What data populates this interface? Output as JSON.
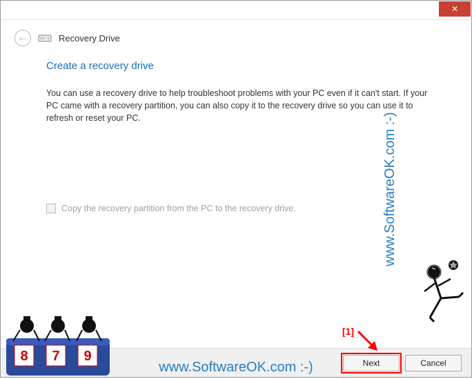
{
  "titlebar": {
    "close_glyph": "✕"
  },
  "header": {
    "back_glyph": "←",
    "title": "Recovery Drive"
  },
  "content": {
    "heading": "Create a recovery drive",
    "body": "You can use a recovery drive to help troubleshoot problems with your PC even if it can't start. If your PC came with a recovery partition, you can also copy it to the recovery drive so you can use it to refresh or reset your PC.",
    "checkbox_label": "Copy the recovery partition from the PC to the recovery drive."
  },
  "footer": {
    "next_label": "Next",
    "cancel_label": "Cancel"
  },
  "annotation": {
    "label": "[1]"
  },
  "watermark": {
    "text": "www.SoftwareOK.com :-)"
  },
  "judges": {
    "scores": [
      "8",
      "7",
      "9"
    ]
  }
}
